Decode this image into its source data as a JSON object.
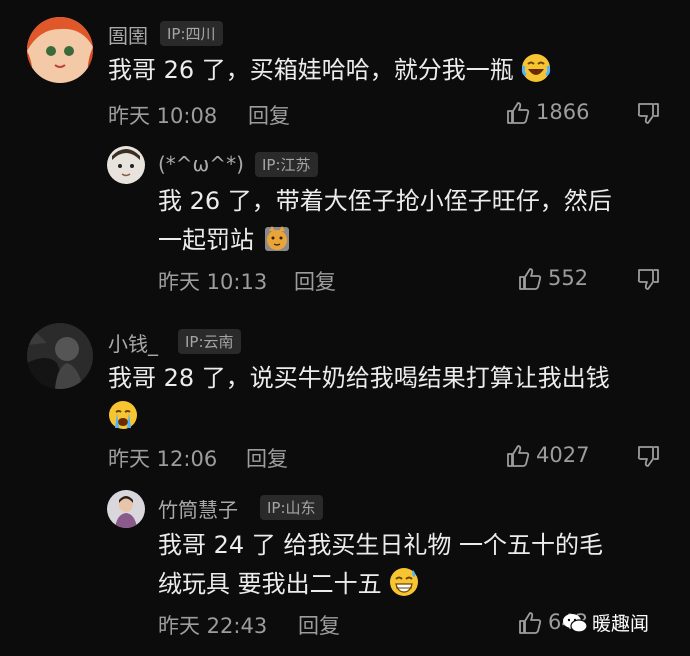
{
  "comments": [
    {
      "username": "圄圉",
      "ip": "IP:四川",
      "text": "我哥 26 了，买箱娃哈哈，就分我一瓶",
      "emoji": "laugh-cry-emoji",
      "time": "昨天 10:08",
      "reply": "回复",
      "likes": "1866",
      "replies": [
        {
          "username": "(*^ω^*)",
          "ip": "IP:江苏",
          "text_lines": [
            "我 26 了，带着大侄子抢小侄子旺仔，然后",
            "一起罚站"
          ],
          "emoji": "cat-sticker-emoji",
          "time": "昨天 10:13",
          "reply": "回复",
          "likes": "552"
        }
      ]
    },
    {
      "username": "小钱_",
      "ip": "IP:云南",
      "text": "我哥 28 了，说买牛奶给我喝结果打算让我出钱",
      "emoji": "crying-emoji",
      "time": "昨天 12:06",
      "reply": "回复",
      "likes": "4027",
      "replies": [
        {
          "username": "竹筒慧子",
          "ip": "IP:山东",
          "text_lines": [
            "我哥 24 了 给我买生日礼物 一个五十的毛",
            "绒玩具 要我出二十五"
          ],
          "emoji": "grin-sweat-emoji",
          "time": "昨天 22:43",
          "reply": "回复",
          "likes": "643"
        }
      ]
    }
  ],
  "watermark": "暖趣闻",
  "colors": {
    "background": "#0c0c0c",
    "text": "#ececec",
    "meta": "#9d9d9d",
    "ip_badge": "#2a2a2a"
  }
}
